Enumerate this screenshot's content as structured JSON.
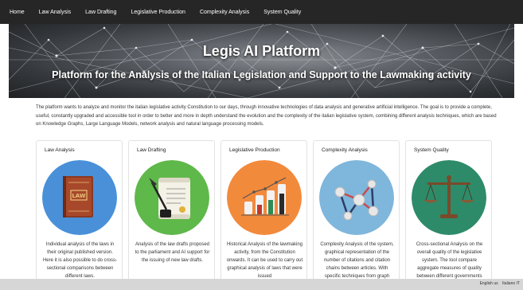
{
  "nav": {
    "items": [
      "Home",
      "Law Analysis",
      "Law Drafting",
      "Legislative Production",
      "Complexity Analysis",
      "System Quality"
    ]
  },
  "hero": {
    "title": "Legis AI Platform",
    "subtitle": "Platform for the Analysis of the Italian Legislation and Support to the Lawmaking activity"
  },
  "intro": "The platform wants to analyze and monitor the italian legislative activity Constitution to our days, through innovative technologies of data analysis and generative artificial intelligence. The goal is to provide a complete, useful, constantly upgraded and accessible tool in order to better and more in depth understand the evolution and the complexity of the italian legislative system, combining different analysis techniques, which are based on Knowledge Graphs, Large Language Models, network analysis and natural language processing models.",
  "cards": [
    {
      "title": "Law Analysis",
      "icon": "law-book-icon",
      "book_label": "LAW",
      "color": "#4a90d9",
      "description": "Individual analysis of the laws in their original published version. Here it is also possible to do cross-sectional comparisons between different laws."
    },
    {
      "title": "Law Drafting",
      "icon": "quill-document-icon",
      "color": "#5fb84a",
      "description": "Analysis of the law drafts proposed to the parliament and AI support for the issuing of new law drafts."
    },
    {
      "title": "Legislative Production",
      "icon": "bar-chart-icon",
      "color": "#f28a3c",
      "description": "Historical Analysis of the lawmaking activity, from the Constitution onwards. It can be used to carry out graphical analysis of laws that were issued"
    },
    {
      "title": "Complexity Analysis",
      "icon": "network-graph-icon",
      "color": "#7fb6dc",
      "description": "Complexity Analysis of the system, graphical representation of the number of citations and citation chains between articles. With specific techniques from graph"
    },
    {
      "title": "System Quality",
      "icon": "scales-icon",
      "color": "#2e8b6a",
      "description": "Cross-sectional Analysis on the overall quality of the legislative system. The tool compare aggregate measures of quality between different governments"
    }
  ],
  "footer": {
    "languages": [
      "English us",
      "Italiano IT"
    ]
  }
}
